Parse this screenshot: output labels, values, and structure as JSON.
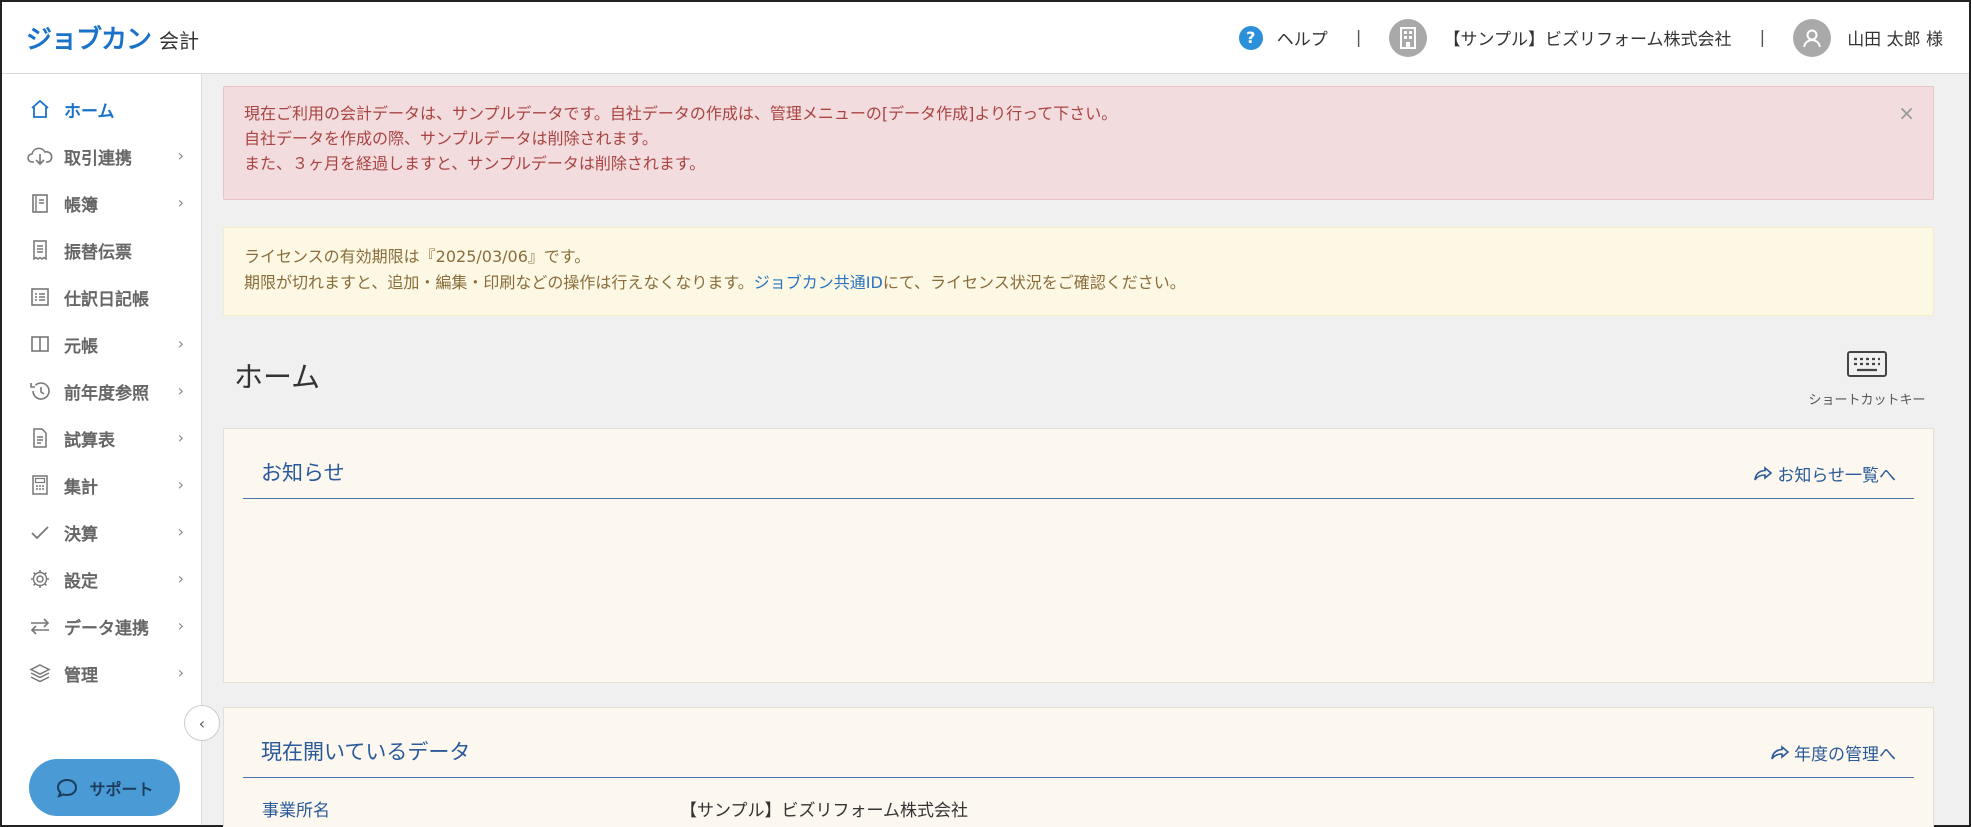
{
  "header": {
    "logo_main": "ジョブカン",
    "logo_sub": "会計",
    "help_label": "ヘルプ",
    "separator": "|",
    "company": "【サンプル】ビズリフォーム株式会社",
    "user": "山田 太郎 様"
  },
  "sidebar": {
    "items": [
      {
        "label": "ホーム",
        "icon": "home-icon",
        "chevron": ""
      },
      {
        "label": "取引連携",
        "icon": "cloud-download-icon",
        "chevron": "›"
      },
      {
        "label": "帳簿",
        "icon": "book-icon",
        "chevron": "›"
      },
      {
        "label": "振替伝票",
        "icon": "receipt-icon",
        "chevron": ""
      },
      {
        "label": "仕訳日記帳",
        "icon": "list-icon",
        "chevron": ""
      },
      {
        "label": "元帳",
        "icon": "columns-icon",
        "chevron": "›"
      },
      {
        "label": "前年度参照",
        "icon": "history-icon",
        "chevron": "›"
      },
      {
        "label": "試算表",
        "icon": "document-icon",
        "chevron": "›"
      },
      {
        "label": "集計",
        "icon": "calculator-icon",
        "chevron": "›"
      },
      {
        "label": "決算",
        "icon": "check-icon",
        "chevron": "›"
      },
      {
        "label": "設定",
        "icon": "gear-icon",
        "chevron": "›"
      },
      {
        "label": "データ連携",
        "icon": "exchange-icon",
        "chevron": "›"
      },
      {
        "label": "管理",
        "icon": "layers-icon",
        "chevron": "›"
      }
    ],
    "collapse_glyph": "‹",
    "support_label": "サポート"
  },
  "alerts": {
    "red_lines": [
      "現在ご利用の会計データは、サンプルデータです。自社データの作成は、管理メニューの[データ作成]より行って下さい。",
      "自社データを作成の際、サンプルデータは削除されます。",
      "また、３ヶ月を経過しますと、サンプルデータは削除されます。"
    ],
    "red_close": "×",
    "yellow_line1": "ライセンスの有効期限は『2025/03/06』です。",
    "yellow_line2_pre": "期限が切れますと、追加・編集・印刷などの操作は行えなくなります。",
    "yellow_link": "ジョブカン共通ID",
    "yellow_line2_post": "にて、ライセンス状況をご確認ください。"
  },
  "page": {
    "title": "ホーム",
    "shortcut_label": "ショートカットキー"
  },
  "panels": {
    "news": {
      "title": "お知らせ",
      "link": "お知らせ一覧へ"
    },
    "current": {
      "title": "現在開いているデータ",
      "link": "年度の管理へ",
      "rows": [
        {
          "key": "事業所名",
          "value": "【サンプル】ビズリフォーム株式会社"
        }
      ]
    }
  },
  "colors": {
    "brand": "#1a73c9",
    "alert_red_bg": "#f2dcde",
    "alert_yellow_bg": "#fcf8e4",
    "support": "#4a9ad6"
  }
}
